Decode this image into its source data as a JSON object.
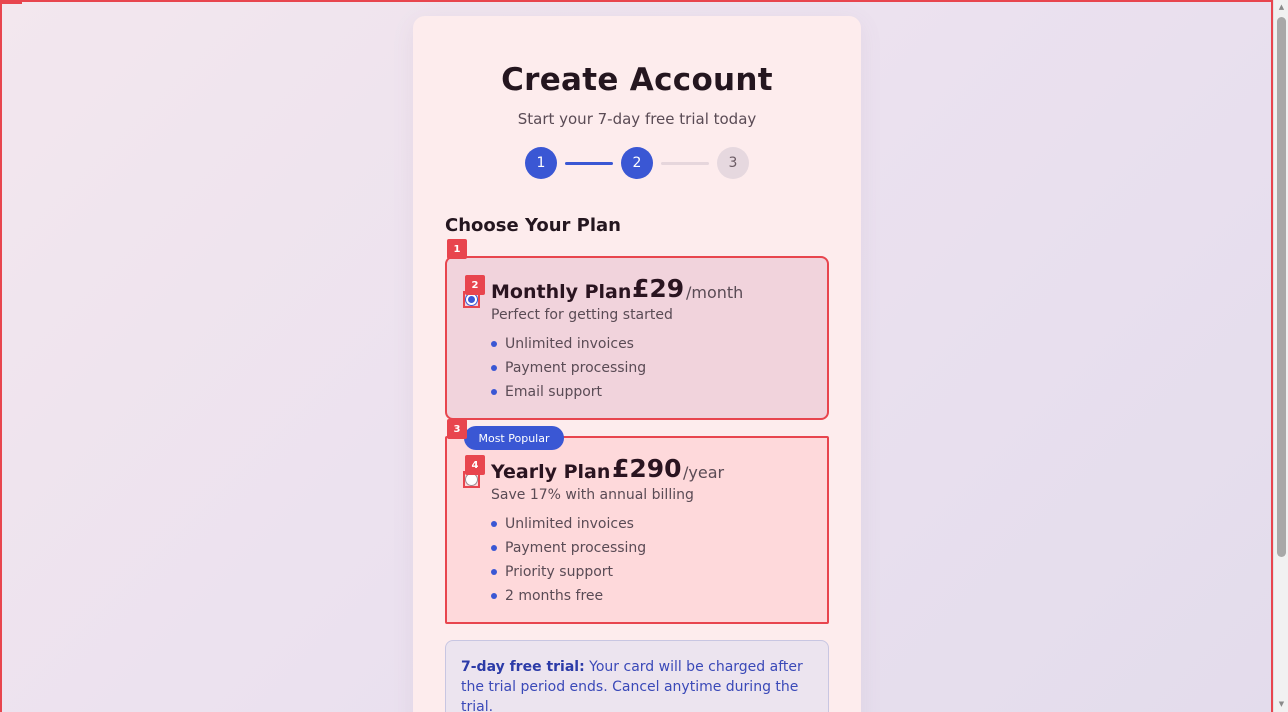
{
  "header": {
    "title": "Create Account",
    "subtitle": "Start your 7-day free trial today"
  },
  "stepper": {
    "steps": [
      {
        "label": "1",
        "status": "complete"
      },
      {
        "label": "2",
        "status": "current"
      },
      {
        "label": "3",
        "status": "upcoming"
      }
    ]
  },
  "plan_section": {
    "heading": "Choose Your Plan",
    "plans": [
      {
        "name": "Monthly Plan",
        "price": "£29",
        "period": "/month",
        "description": "Perfect for getting started",
        "selected": true,
        "features": [
          "Unlimited invoices",
          "Payment processing",
          "Email support"
        ]
      },
      {
        "name": "Yearly Plan",
        "price": "£290",
        "period": "/year",
        "description": "Save 17% with annual billing",
        "selected": false,
        "badge": "Most Popular",
        "features": [
          "Unlimited invoices",
          "Payment processing",
          "Priority support",
          "2 months free"
        ]
      }
    ]
  },
  "trial_notice": {
    "label": "7-day free trial:",
    "text": " Your card will be charged after the trial period ends. Cancel anytime during the trial."
  },
  "markers": [
    "1",
    "2",
    "3",
    "4"
  ],
  "colors": {
    "accent": "#3a57d4",
    "marker": "#e8454e",
    "monthly_card": "#f1d3dc",
    "yearly_card": "#fed9db"
  }
}
